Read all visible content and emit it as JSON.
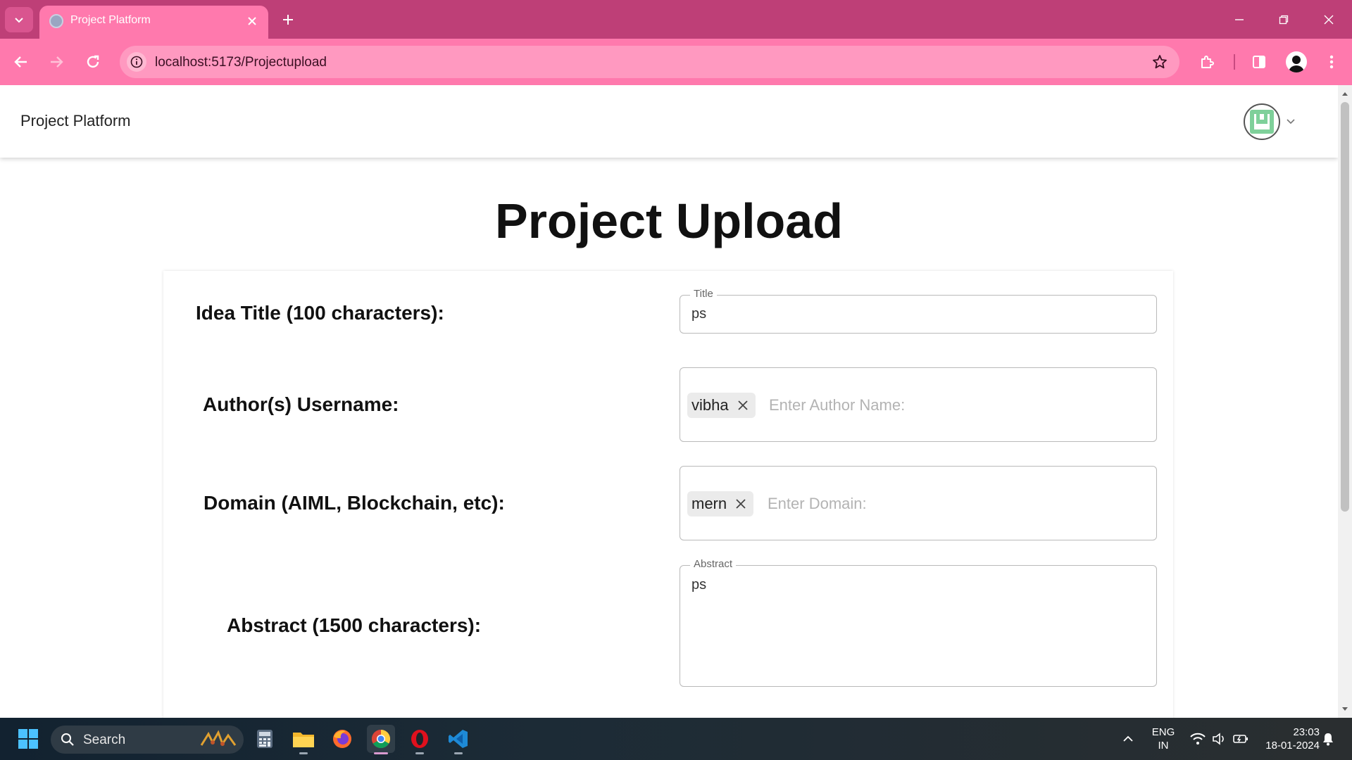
{
  "browser": {
    "tab_title": "Project Platform",
    "url": "localhost:5173/Projectupload"
  },
  "app": {
    "brand": "Project Platform"
  },
  "page": {
    "title": "Project Upload"
  },
  "form": {
    "title_label": "Idea Title (100 characters):",
    "title_legend": "Title",
    "title_value": "ps",
    "authors_label": "Author(s) Username:",
    "authors_chip": "vibha",
    "authors_placeholder": "Enter Author Name:",
    "domain_label": "Domain (AIML, Blockchain, etc):",
    "domain_chip": "mern",
    "domain_placeholder": "Enter Domain:",
    "abstract_label": "Abstract (1500 characters):",
    "abstract_legend": "Abstract",
    "abstract_value": "ps"
  },
  "taskbar": {
    "search_label": "Search",
    "language_line1": "ENG",
    "language_line2": "IN",
    "time": "23:03",
    "date": "18-01-2024"
  },
  "colors": {
    "tabbar": "#be3f77",
    "toolbar": "#ff79ad",
    "omnibox": "#ff99c0"
  }
}
